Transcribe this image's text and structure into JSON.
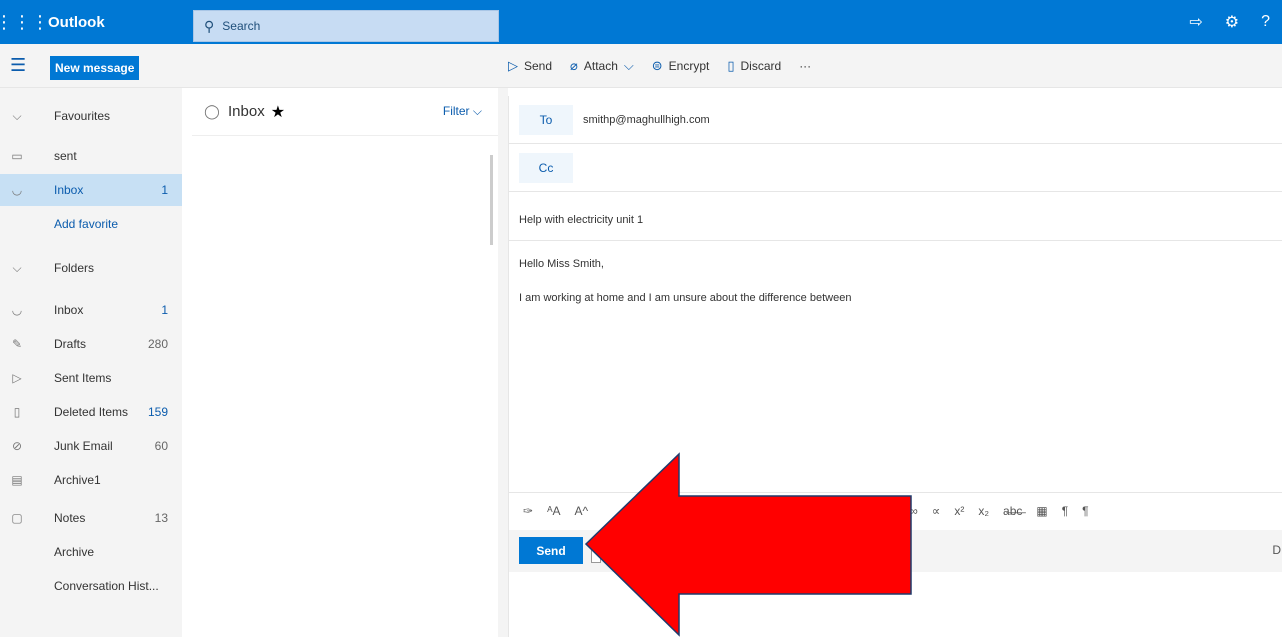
{
  "topbar": {
    "app_name": "Outlook",
    "search_placeholder": "Search",
    "bg_color": "#0078d4"
  },
  "toolbar": {
    "new_message": "New message",
    "send": "Send",
    "attach": "Attach",
    "encrypt": "Encrypt",
    "discard": "Discard",
    "more": "···"
  },
  "sidebar": {
    "favourites": "Favourites",
    "fav_sent": "sent",
    "fav_inbox": "Inbox",
    "fav_inbox_count": "1",
    "add_favorite": "Add favorite",
    "folders": "Folders",
    "inbox": "Inbox",
    "inbox_count": "1",
    "drafts": "Drafts",
    "drafts_count": "280",
    "sent_items": "Sent Items",
    "deleted_items": "Deleted Items",
    "deleted_count": "159",
    "junk_email": "Junk Email",
    "junk_count": "60",
    "archive1": "Archive1",
    "notes": "Notes",
    "notes_count": "13",
    "archive": "Archive",
    "conversation_history": "Conversation Hist..."
  },
  "message_list": {
    "title": "Inbox",
    "filter": "Filter"
  },
  "compose": {
    "to_label": "To",
    "to_value": "smithp@maghullhigh.com",
    "cc_label": "Cc",
    "subject": "Help with electricity unit 1",
    "body_line1": "Hello Miss Smith,",
    "body_line2": "I am working at home and I am unsure about the difference between",
    "send": "Send",
    "drafts_truncated": "D"
  },
  "annotation": {
    "arrow_color": "#ff0000"
  }
}
